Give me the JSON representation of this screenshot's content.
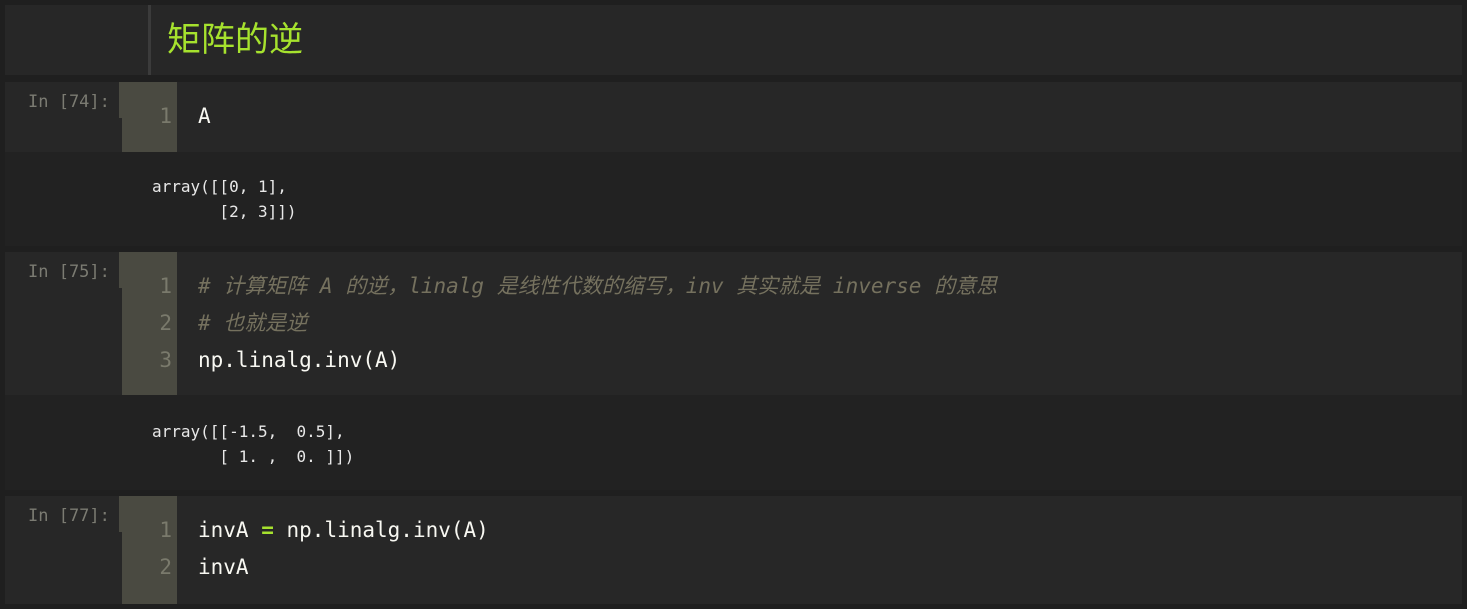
{
  "markdown": {
    "heading": "矩阵的逆"
  },
  "cells": [
    {
      "prompt": "In [74]:",
      "lines": [
        {
          "no": "1",
          "code": "A"
        }
      ],
      "output": [
        "array([[0, 1],",
        "       [2, 3]])"
      ]
    },
    {
      "prompt": "In [75]:",
      "lines": [
        {
          "no": "1",
          "comment": "# 计算矩阵 A 的逆，linalg 是线性代数的缩写，inv 其实就是 inverse 的意思"
        },
        {
          "no": "2",
          "comment": "# 也就是逆"
        },
        {
          "no": "3",
          "code": "np.linalg.inv(A)"
        }
      ],
      "output": [
        "array([[-1.5,  0.5],",
        "       [ 1. ,  0. ]])"
      ]
    },
    {
      "prompt": "In [77]:",
      "lines": [
        {
          "no": "1",
          "code_left": "invA ",
          "op": "=",
          "code_right": " np.linalg.inv(A)"
        },
        {
          "no": "2",
          "code": "invA"
        }
      ]
    }
  ],
  "colors": {
    "background": "#1f1f1f",
    "cell": "#272727",
    "gutter": "#4a4a41",
    "heading": "#a6e22e",
    "comment": "#75715e",
    "operator": "#a6e22e",
    "text": "#f8f8f2"
  }
}
